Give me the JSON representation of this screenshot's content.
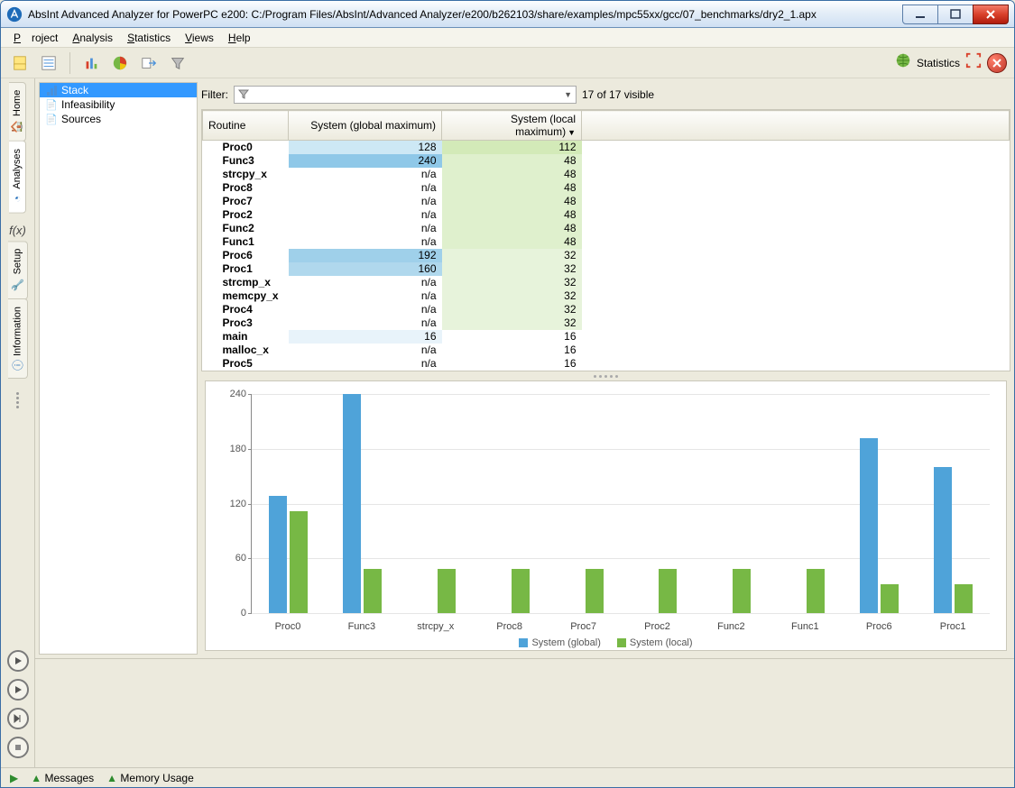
{
  "window": {
    "title": "AbsInt Advanced Analyzer for PowerPC e200: C:/Program Files/AbsInt/Advanced Analyzer/e200/b262103/share/examples/mpc55xx/gcc/07_benchmarks/dry2_1.apx"
  },
  "menubar": {
    "items": [
      "Project",
      "Analysis",
      "Statistics",
      "Views",
      "Help"
    ]
  },
  "rail": {
    "tabs": [
      "Home",
      "Analyses",
      "Setup",
      "Information"
    ],
    "fx": "f(x)"
  },
  "tree": {
    "items": [
      "Stack",
      "Infeasibility",
      "Sources"
    ],
    "selected": 0
  },
  "filter": {
    "label": "Filter:",
    "visible_text": "17 of 17 visible"
  },
  "toolbar_right": {
    "stats": "Statistics"
  },
  "table": {
    "headers": {
      "routine": "Routine",
      "global": "System (global maximum)",
      "local": "System (local maximum)"
    },
    "rows": [
      {
        "routine": "Proc0",
        "global": "128",
        "local": "112",
        "gcolor": "#cde8f5",
        "lcolor": "#d3eab8"
      },
      {
        "routine": "Func3",
        "global": "240",
        "local": "48",
        "gcolor": "#8fc8e8",
        "lcolor": "#dff0cd"
      },
      {
        "routine": "strcpy_x",
        "global": "n/a",
        "local": "48",
        "gcolor": "",
        "lcolor": "#dff0cd"
      },
      {
        "routine": "Proc8",
        "global": "n/a",
        "local": "48",
        "gcolor": "",
        "lcolor": "#dff0cd"
      },
      {
        "routine": "Proc7",
        "global": "n/a",
        "local": "48",
        "gcolor": "",
        "lcolor": "#dff0cd"
      },
      {
        "routine": "Proc2",
        "global": "n/a",
        "local": "48",
        "gcolor": "",
        "lcolor": "#dff0cd"
      },
      {
        "routine": "Func2",
        "global": "n/a",
        "local": "48",
        "gcolor": "",
        "lcolor": "#dff0cd"
      },
      {
        "routine": "Func1",
        "global": "n/a",
        "local": "48",
        "gcolor": "",
        "lcolor": "#dff0cd"
      },
      {
        "routine": "Proc6",
        "global": "192",
        "local": "32",
        "gcolor": "#9fd0ea",
        "lcolor": "#e7f3db"
      },
      {
        "routine": "Proc1",
        "global": "160",
        "local": "32",
        "gcolor": "#b0d8ed",
        "lcolor": "#e7f3db"
      },
      {
        "routine": "strcmp_x",
        "global": "n/a",
        "local": "32",
        "gcolor": "",
        "lcolor": "#e7f3db"
      },
      {
        "routine": "memcpy_x",
        "global": "n/a",
        "local": "32",
        "gcolor": "",
        "lcolor": "#e7f3db"
      },
      {
        "routine": "Proc4",
        "global": "n/a",
        "local": "32",
        "gcolor": "",
        "lcolor": "#e7f3db"
      },
      {
        "routine": "Proc3",
        "global": "n/a",
        "local": "32",
        "gcolor": "",
        "lcolor": "#e7f3db"
      },
      {
        "routine": "main",
        "global": "16",
        "local": "16",
        "gcolor": "#e8f3fa",
        "lcolor": ""
      },
      {
        "routine": "malloc_x",
        "global": "n/a",
        "local": "16",
        "gcolor": "",
        "lcolor": ""
      },
      {
        "routine": "Proc5",
        "global": "n/a",
        "local": "16",
        "gcolor": "",
        "lcolor": ""
      }
    ]
  },
  "statusbar": {
    "messages": "Messages",
    "memory": "Memory Usage"
  },
  "chart_data": {
    "type": "bar",
    "categories": [
      "Proc0",
      "Func3",
      "strcpy_x",
      "Proc8",
      "Proc7",
      "Proc2",
      "Func2",
      "Func1",
      "Proc6",
      "Proc1"
    ],
    "series": [
      {
        "name": "System (global)",
        "values": [
          128,
          240,
          null,
          null,
          null,
          null,
          null,
          null,
          192,
          160
        ]
      },
      {
        "name": "System (local)",
        "values": [
          112,
          48,
          48,
          48,
          48,
          48,
          48,
          48,
          32,
          32
        ]
      }
    ],
    "ylim": [
      0,
      240
    ],
    "yticks": [
      0,
      60,
      120,
      180,
      240
    ]
  }
}
